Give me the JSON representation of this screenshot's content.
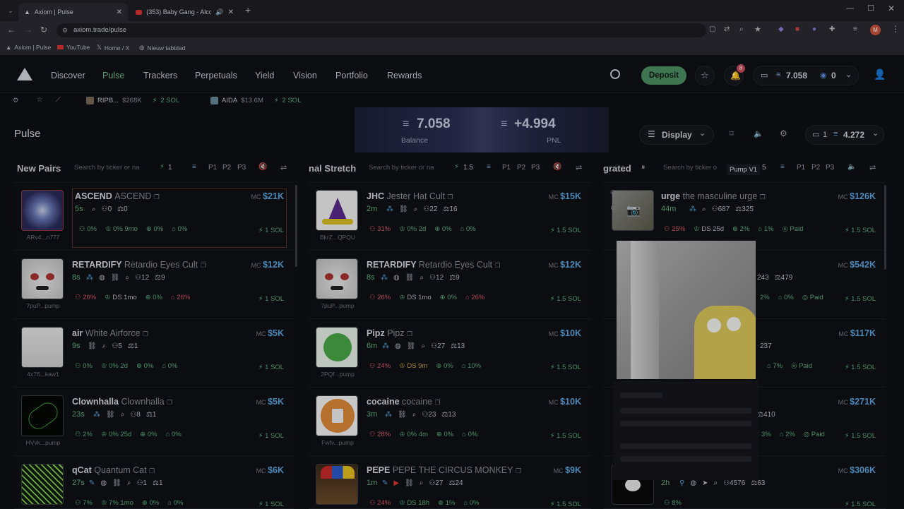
{
  "browser": {
    "tabs": [
      {
        "label": "Axiom | Pulse",
        "active": true
      },
      {
        "label": "(353) Baby Gang - Alcott Z...",
        "active": false
      }
    ],
    "url": "axiom.trade/pulse",
    "bookmarks": [
      "Axiom | Pulse",
      "YouTube",
      "Home / X",
      "Nieuw tabblad"
    ],
    "profile_initial": "M"
  },
  "header": {
    "nav": [
      "Discover",
      "Pulse",
      "Trackers",
      "Perpetuals",
      "Yield",
      "Vision",
      "Portfolio",
      "Rewards"
    ],
    "active_nav": "Pulse",
    "deposit_label": "Deposit",
    "notif_count": "8",
    "wallet_balance": "7.058",
    "wallet_count": "0"
  },
  "subbar": {
    "watch": [
      {
        "name": "RIPB...",
        "mc": "$268K",
        "sol": "2 SOL"
      },
      {
        "name": "AIDA",
        "mc": "$13.6M",
        "sol": "2 SOL"
      }
    ]
  },
  "page_title": "Pulse",
  "banner": {
    "balance": "7.058",
    "balance_label": "Balance",
    "pnl": "+4.994",
    "pnl_label": "PNL"
  },
  "display": {
    "label": "Display",
    "wallet_num": "1",
    "wallet_amount": "4.272"
  },
  "columns": [
    {
      "name": "New Pairs",
      "search": "Search by ticker or na",
      "qty": "1",
      "presets": [
        "P1",
        "P2",
        "P3"
      ]
    },
    {
      "name": "nal Stretch",
      "search": "Search by ticker or na",
      "qty": "1.5",
      "presets": [
        "P1",
        "P2",
        "P3"
      ]
    },
    {
      "name": "grated",
      "search": "Search by ticker o",
      "qty": "5",
      "presets": [
        "P1",
        "P2",
        "P3"
      ],
      "tooltip": "Pump V1"
    }
  ],
  "col1": [
    {
      "ticker": "ASCEND",
      "full": "ASCEND",
      "age": "5s",
      "holders": "0",
      "pro": "0",
      "p1": "0%",
      "p2": "0% 9mo",
      "p3": "0%",
      "p4": "0%",
      "mc": "$21K",
      "sol": "1 SOL",
      "addr": "ARv4...n777"
    },
    {
      "ticker": "RETARDIFY",
      "full": "Retardio Eyes Cult",
      "age": "8s",
      "holders": "12",
      "pro": "9",
      "p1": "26%",
      "p2": "DS 1mo",
      "p3": "0%",
      "p4": "26%",
      "mc": "$12K",
      "sol": "1 SOL",
      "addr": "7puP...pump"
    },
    {
      "ticker": "air",
      "full": "White Airforce",
      "age": "9s",
      "holders": "5",
      "pro": "1",
      "p1": "0%",
      "p2": "0% 2d",
      "p3": "0%",
      "p4": "0%",
      "mc": "$5K",
      "sol": "1 SOL",
      "addr": "4x76...kaw1"
    },
    {
      "ticker": "Clownhalla",
      "full": "Clownhalla",
      "age": "23s",
      "holders": "8",
      "pro": "1",
      "p1": "2%",
      "p2": "0% 25d",
      "p3": "0%",
      "p4": "0%",
      "mc": "$5K",
      "sol": "1 SOL",
      "addr": "HVvk...pump"
    },
    {
      "ticker": "qCat",
      "full": "Quantum Cat",
      "age": "27s",
      "holders": "1",
      "pro": "1",
      "p1": "7%",
      "p2": "7% 1mo",
      "p3": "0%",
      "p4": "0%",
      "mc": "$6K",
      "sol": "1 SOL",
      "addr": ""
    }
  ],
  "col2": [
    {
      "ticker": "JHC",
      "full": "Jester Hat Cult",
      "age": "2m",
      "holders": "22",
      "pro": "16",
      "p1": "31%",
      "p2": "0% 2d",
      "p3": "0%",
      "p4": "0%",
      "mc": "$15K",
      "sol": "1.5 SOL",
      "addr": "BkrZ...QPQU"
    },
    {
      "ticker": "RETARDIFY",
      "full": "Retardio Eyes Cult",
      "age": "8s",
      "holders": "12",
      "pro": "9",
      "p1": "26%",
      "p2": "DS 1mo",
      "p3": "0%",
      "p4": "26%",
      "mc": "$12K",
      "sol": "1.5 SOL",
      "addr": "7puP...pump"
    },
    {
      "ticker": "Pipz",
      "full": "Pipz",
      "age": "6m",
      "holders": "27",
      "pro": "13",
      "p1": "24%",
      "p2": "DS 9m",
      "p3": "0%",
      "p4": "10%",
      "mc": "$10K",
      "sol": "1.5 SOL",
      "addr": "2PQf...pump"
    },
    {
      "ticker": "cocaine",
      "full": "cocaine",
      "age": "3m",
      "holders": "23",
      "pro": "13",
      "p1": "28%",
      "p2": "0% 4m",
      "p3": "0%",
      "p4": "0%",
      "mc": "$10K",
      "sol": "1.5 SOL",
      "addr": "Fwfv...pump"
    },
    {
      "ticker": "PEPE",
      "full": "PEPE THE CIRCUS MONKEY",
      "age": "1m",
      "holders": "27",
      "pro": "24",
      "p1": "24%",
      "p2": "DS 18h",
      "p3": "1%",
      "p4": "0%",
      "mc": "$9K",
      "sol": "1.5 SOL",
      "addr": ""
    }
  ],
  "col3": [
    {
      "ticker": "urge",
      "full": "the masculine urge",
      "age": "44m",
      "holders": "687",
      "pro": "325",
      "p1": "25%",
      "p2": "DS 25d",
      "p3": "2%",
      "p4": "1%",
      "paid": "Paid",
      "mc": "$126K",
      "sol": "1.5 SOL"
    },
    {
      "holders": "243",
      "pro": "479",
      "p3": "2%",
      "p4": "0%",
      "paid": "Paid",
      "mc": "$542K",
      "sol": "1.5 SOL"
    },
    {
      "holders": "237",
      "p4": "7%",
      "paid": "Paid",
      "mc": "$117K",
      "sol": "1.5 SOL"
    },
    {
      "pro": "410",
      "p3": "3%",
      "p4": "2%",
      "paid": "Paid",
      "mc": "$271K",
      "sol": "1.5 SOL"
    },
    {
      "age": "2h",
      "holders": "4576",
      "pro": "63",
      "p1": "8%",
      "mc": "$306K",
      "sol": "1.5 SOL"
    }
  ]
}
